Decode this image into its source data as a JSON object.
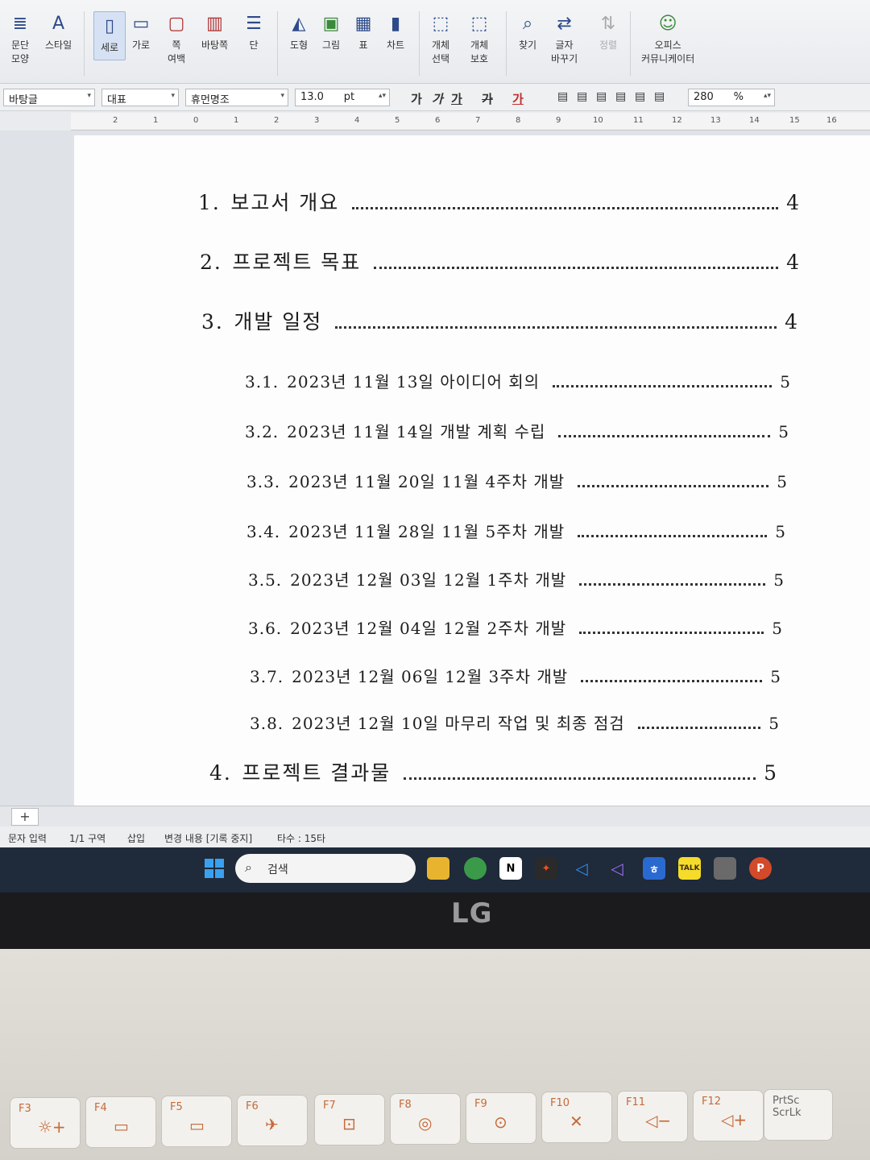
{
  "ribbon": {
    "buttons": [
      {
        "id": "para",
        "label": "문단\n모양",
        "icon": "paragraph-icon"
      },
      {
        "id": "style",
        "label": "스타일",
        "icon": "style-icon"
      },
      {
        "id": "portrait",
        "label": "세로",
        "icon": "portrait-icon"
      },
      {
        "id": "landscape",
        "label": "가로",
        "icon": "landscape-icon"
      },
      {
        "id": "margin",
        "label": "쪽\n여백",
        "icon": "margin-icon"
      },
      {
        "id": "background",
        "label": "바탕쪽",
        "icon": "background-icon"
      },
      {
        "id": "columns",
        "label": "단",
        "icon": "columns-icon"
      },
      {
        "id": "shape",
        "label": "도형",
        "icon": "shape-icon"
      },
      {
        "id": "picture",
        "label": "그림",
        "icon": "picture-icon"
      },
      {
        "id": "table",
        "label": "표",
        "icon": "table-icon"
      },
      {
        "id": "chart",
        "label": "차트",
        "icon": "chart-icon"
      },
      {
        "id": "objsel",
        "label": "개체\n선택",
        "icon": "object-select-icon"
      },
      {
        "id": "objprot",
        "label": "개체\n보호",
        "icon": "object-protect-icon"
      },
      {
        "id": "find",
        "label": "찾기",
        "icon": "find-icon"
      },
      {
        "id": "replace",
        "label": "글자\n바꾸기",
        "icon": "replace-icon"
      },
      {
        "id": "sort",
        "label": "정렬",
        "icon": "sort-icon"
      },
      {
        "id": "community",
        "label": "오피스\n커뮤니케이터",
        "icon": "communicator-icon"
      }
    ]
  },
  "format": {
    "style": "바탕글",
    "lang": "대표",
    "font": "휴먼명조",
    "size": "13.0",
    "unit": "pt",
    "zoom": "280",
    "zoom_unit": "%",
    "bold": "가",
    "italic": "가",
    "underline": "가",
    "strike": "가",
    "color": "가"
  },
  "ruler": [
    "2",
    "1",
    "0",
    "1",
    "2",
    "3",
    "4",
    "5",
    "6",
    "7",
    "8",
    "9",
    "10",
    "11",
    "12",
    "13",
    "14",
    "15",
    "16"
  ],
  "toc": [
    {
      "num": "1.",
      "title": "보고서 개요",
      "page": "4",
      "level": 1
    },
    {
      "num": "2.",
      "title": "프로젝트 목표",
      "page": "4",
      "level": 1
    },
    {
      "num": "3.",
      "title": "개발 일정",
      "page": "4",
      "level": 1
    },
    {
      "num": "3.1.",
      "title": "2023년 11월 13일 아이디어 회의",
      "page": "5",
      "level": 2
    },
    {
      "num": "3.2.",
      "title": "2023년 11월 14일 개발 계획 수립",
      "page": "5",
      "level": 2
    },
    {
      "num": "3.3.",
      "title": "2023년 11월 20일 11월 4주차 개발",
      "page": "5",
      "level": 2
    },
    {
      "num": "3.4.",
      "title": "2023년 11월 28일 11월 5주차 개발",
      "page": "5",
      "level": 2
    },
    {
      "num": "3.5.",
      "title": "2023년 12월 03일 12월 1주차 개발",
      "page": "5",
      "level": 2
    },
    {
      "num": "3.6.",
      "title": "2023년 12월 04일 12월 2주차 개발",
      "page": "5",
      "level": 2
    },
    {
      "num": "3.7.",
      "title": "2023년 12월 06일 12월 3주차 개발",
      "page": "5",
      "level": 2
    },
    {
      "num": "3.8.",
      "title": "2023년 12월 10일 마무리 작업 및 최종 점검",
      "page": "5",
      "level": 2
    },
    {
      "num": "4.",
      "title": "프로젝트 결과물",
      "page": "5",
      "level": 1
    }
  ],
  "tabs": {
    "add": "+"
  },
  "status": {
    "mode": "문자 입력",
    "section": "1/1 구역",
    "insert": "삽입",
    "track": "변경 내용 [기록 중지]",
    "typing": "타수 : 15타"
  },
  "taskbar": {
    "search_placeholder": "검색",
    "apps": [
      "file-explorer",
      "chrome",
      "notion",
      "figma",
      "vscode",
      "visual-studio",
      "hancom",
      "kakaotalk",
      "app",
      "powerpoint"
    ]
  },
  "laptop": {
    "brand": "LG",
    "keys": [
      {
        "label": "F3",
        "icon": "☼+"
      },
      {
        "label": "F4",
        "icon": "▭"
      },
      {
        "label": "F5",
        "icon": "▭"
      },
      {
        "label": "F6",
        "icon": "✈"
      },
      {
        "label": "F7",
        "icon": "⊡"
      },
      {
        "label": "F8",
        "icon": "◎"
      },
      {
        "label": "F9",
        "icon": "⊙"
      },
      {
        "label": "F10",
        "icon": "✕"
      },
      {
        "label": "F11",
        "icon": "◁−"
      },
      {
        "label": "F12",
        "icon": "◁+"
      },
      {
        "label": "PrtSc\nScrLk",
        "icon": ""
      }
    ]
  }
}
